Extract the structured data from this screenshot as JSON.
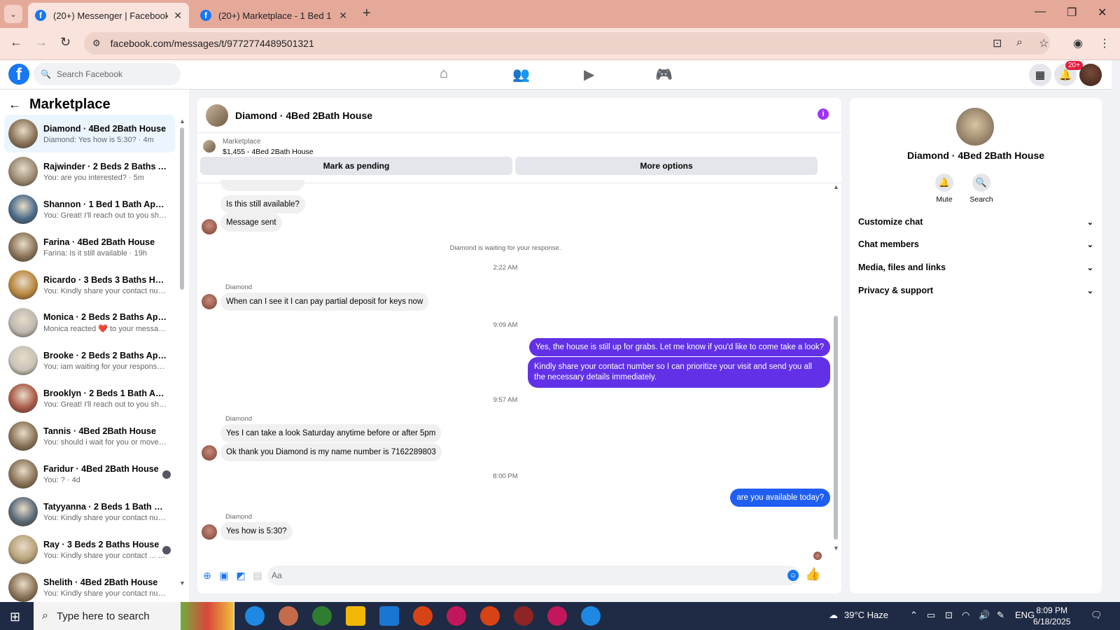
{
  "browser": {
    "tabs": [
      {
        "title": "(20+) Messenger | Facebook",
        "active": true
      },
      {
        "title": "(20+) Marketplace - 1 Bed 1 Ba",
        "active": false
      }
    ],
    "url": "facebook.com/messages/t/9772774489501321"
  },
  "fb": {
    "search_placeholder": "Search Facebook",
    "notif_badge": "20+"
  },
  "left": {
    "title": "Marketplace",
    "conversations": [
      {
        "name": "Diamond · 4Bed 2Bath House",
        "preview": "Diamond: Yes how is 5:30? · 4m",
        "color": "#8a7358"
      },
      {
        "name": "Rajwinder · 2 Beds 2 Baths Apar...",
        "preview": "You: are you interested? · 5m",
        "color": "#9a8a74"
      },
      {
        "name": "Shannon · 1 Bed 1 Bath Apartm...",
        "preview": "You: Great! I'll reach out to you sh... · 6m",
        "color": "#4a6a8a"
      },
      {
        "name": "Farina · 4Bed 2Bath House",
        "preview": "Farina: Is it still available · 19h",
        "color": "#8a7358"
      },
      {
        "name": "Ricardo · 3 Beds 3 Baths House",
        "preview": "You: Kindly share your contact nu... · 2d",
        "color": "#b8863e"
      },
      {
        "name": "Monica · 2 Beds 2 Baths Apart...",
        "preview": "Monica reacted ❤️ to your messa... · 3d",
        "color": "#bdb8b0"
      },
      {
        "name": "Brooke · 2 Beds 2 Baths Apartm...",
        "preview": "You: iam waiting for your response. · 3d",
        "color": "#c8c2b8"
      },
      {
        "name": "Brooklyn · 2 Beds 1 Bath Apart...",
        "preview": "You: Great! I'll reach out to you sh... · 4d",
        "color": "#a85a48"
      },
      {
        "name": "Tannis · 4Bed 2Bath House",
        "preview": "You: should i wait for you or move... · 4d",
        "color": "#8a7358"
      },
      {
        "name": "Faridur · 4Bed 2Bath House",
        "preview": "You: ? · 4d",
        "color": "#8a7358"
      },
      {
        "name": "Tatyyanna · 2 Beds 1 Bath House",
        "preview": "You: Kindly share your contact nu... · 4d",
        "color": "#5a6a78"
      },
      {
        "name": "Ray · 3 Beds 2 Baths House",
        "preview": "You: Kindly share your contact ... · 4d",
        "color": "#b8a27a"
      },
      {
        "name": "Shelith · 4Bed 2Bath House",
        "preview": "You: Kindly share your contact nu... · 4d",
        "color": "#8a7358"
      }
    ]
  },
  "chat": {
    "title": "Diamond · 4Bed 2Bath House",
    "marketplace_label": "Marketplace",
    "listing": "$1,455 - 4Bed 2Bath House",
    "mark_pending": "Mark as pending",
    "more_options": "More options",
    "msg_available": "Is this still available?",
    "msg_sent": "Message sent",
    "waiting_note": "Diamond is waiting for your response.",
    "ts1": "2:22 AM",
    "sender": "Diamond",
    "msg_keys": "When can I see it I can pay partial deposit for keys now",
    "ts2": "9:09 AM",
    "out1": "Yes, the house is still up for grabs. Let me know if you'd like to come take a look?",
    "out2": "Kindly share your contact number so I can prioritize your visit and send you all the necessary details immediately.",
    "ts3": "9:57 AM",
    "msg_saturday": "Yes I can take a look Saturday anytime before or after 5pm",
    "msg_number": "Ok thank you Diamond is my name number is 7162289803",
    "ts4": "8:00 PM",
    "out3": "are you available today?",
    "msg_530": "Yes how is 5:30?",
    "composer_placeholder": "Aa"
  },
  "right": {
    "name": "Diamond · 4Bed 2Bath House",
    "mute": "Mute",
    "search": "Search",
    "sections": [
      "Customize chat",
      "Chat members",
      "Media, files and links",
      "Privacy & support"
    ]
  },
  "taskbar": {
    "search_placeholder": "Type here to search",
    "weather": "39°C  Haze",
    "lang": "ENG",
    "time": "8:09 PM",
    "date": "6/18/2025"
  }
}
